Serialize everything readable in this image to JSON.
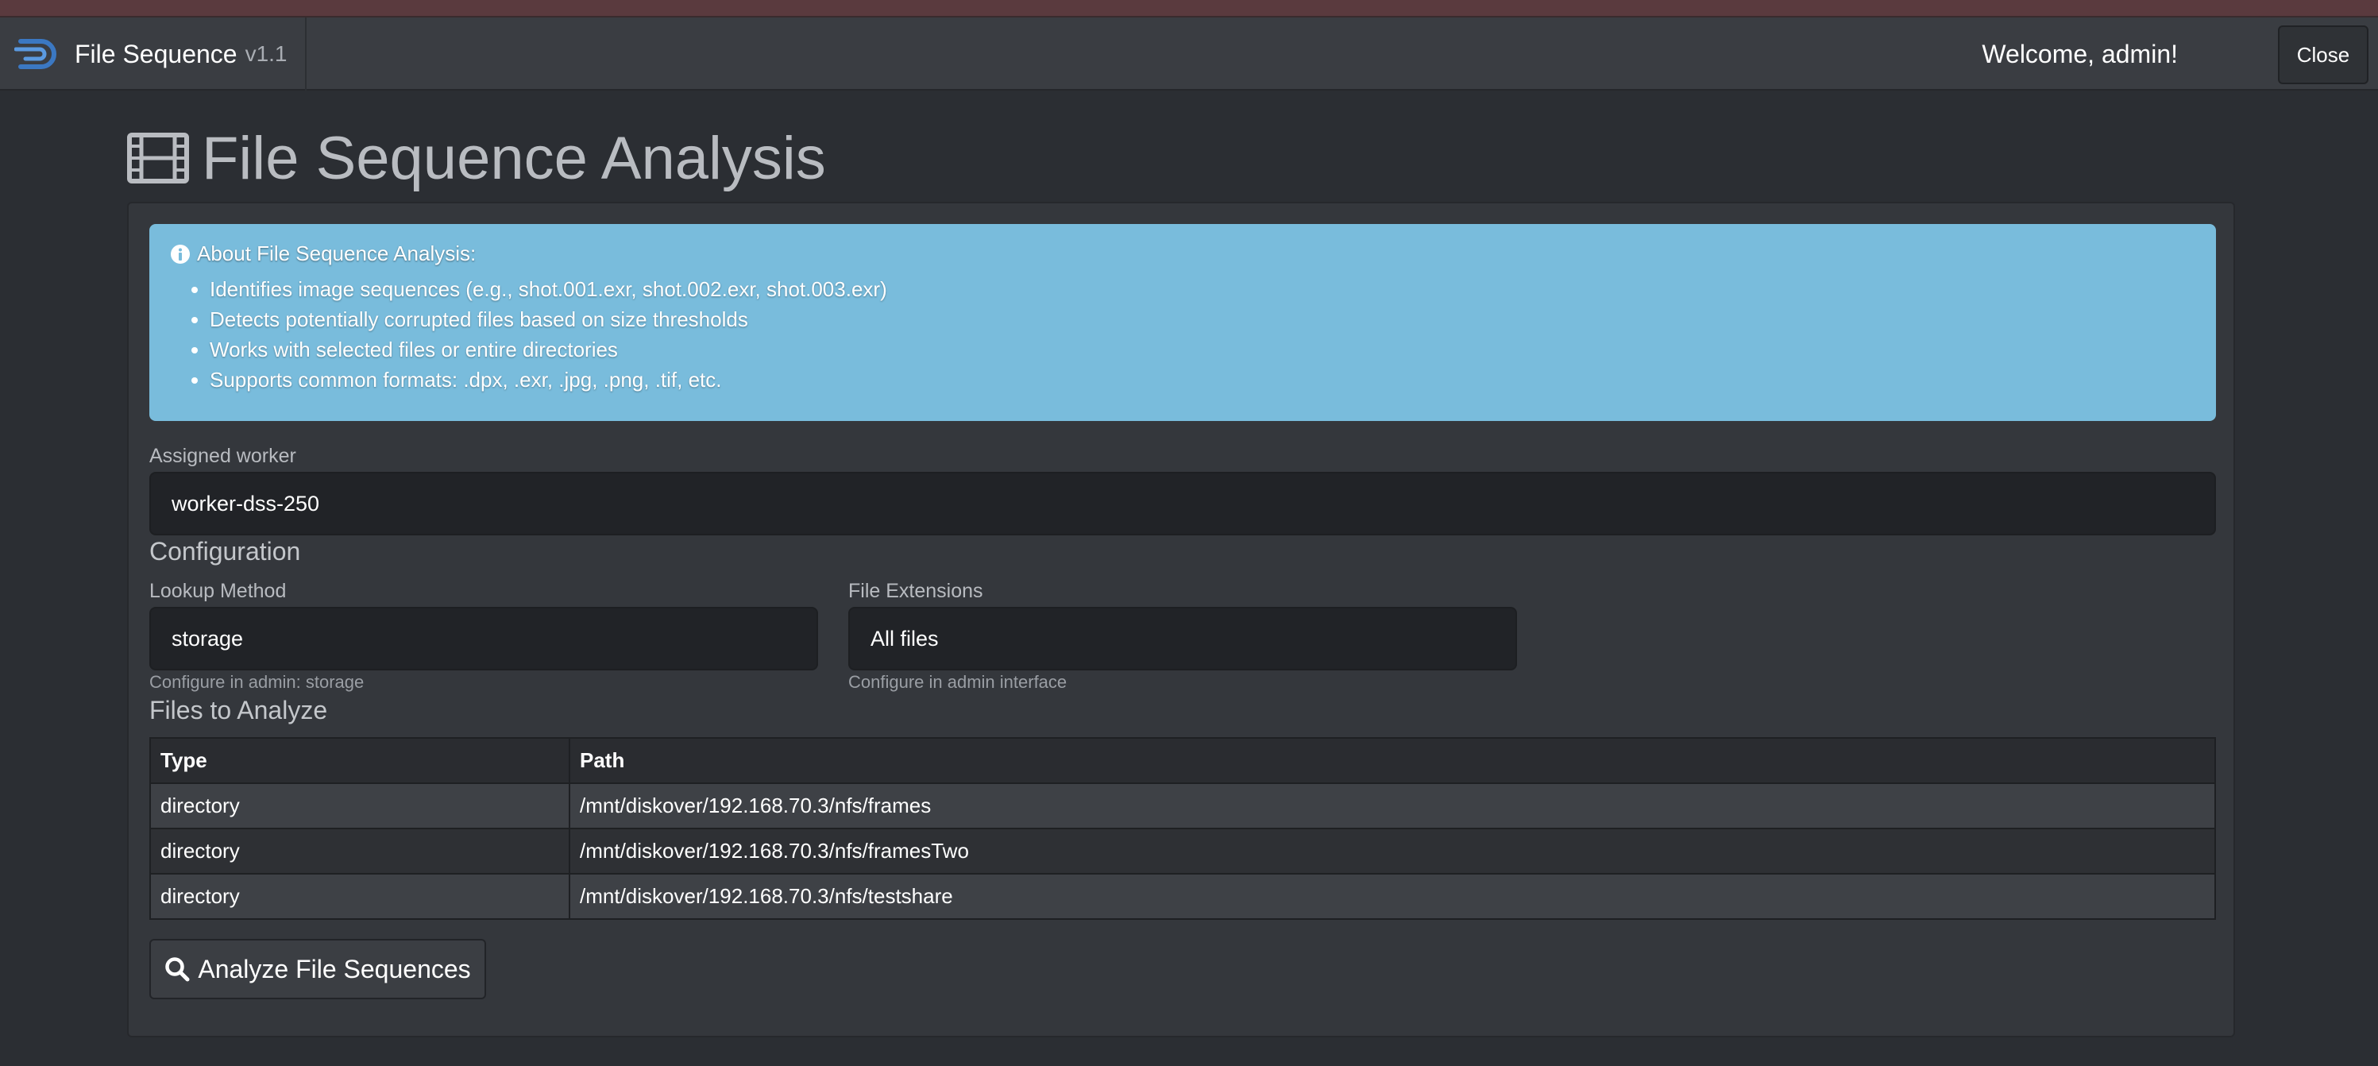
{
  "app": {
    "name": "File Sequence",
    "version": "v1.1",
    "welcome": "Welcome, admin!",
    "close_label": "Close"
  },
  "page": {
    "title": "File Sequence Analysis"
  },
  "info": {
    "heading": "About File Sequence Analysis:",
    "items": [
      "Identifies image sequences (e.g., shot.001.exr, shot.002.exr, shot.003.exr)",
      "Detects potentially corrupted files based on size thresholds",
      "Works with selected files or entire directories",
      "Supports common formats: .dpx, .exr, .jpg, .png, .tif, etc."
    ]
  },
  "worker": {
    "label": "Assigned worker",
    "value": "worker-dss-250"
  },
  "config": {
    "title": "Configuration",
    "lookup_label": "Lookup Method",
    "lookup_value": "storage",
    "lookup_help": "Configure in admin: storage",
    "ext_label": "File Extensions",
    "ext_value": "All files",
    "ext_help": "Configure in admin interface"
  },
  "files": {
    "title": "Files to Analyze",
    "headers": [
      "Type",
      "Path"
    ],
    "rows": [
      {
        "type": "directory",
        "path": "/mnt/diskover/192.168.70.3/nfs/frames"
      },
      {
        "type": "directory",
        "path": "/mnt/diskover/192.168.70.3/nfs/framesTwo"
      },
      {
        "type": "directory",
        "path": "/mnt/diskover/192.168.70.3/nfs/testshare"
      }
    ]
  },
  "actions": {
    "analyze_label": "Analyze File Sequences"
  },
  "icons": {
    "logo": "diskover-logo-icon",
    "title": "film-icon",
    "info": "info-circle-icon",
    "analyze": "search-icon"
  },
  "colors": {
    "info_background": "#79bcdc",
    "logo_blue": "#3b78c2"
  }
}
